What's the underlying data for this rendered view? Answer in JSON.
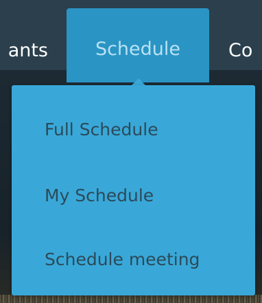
{
  "nav": {
    "items": [
      {
        "label": "ants"
      },
      {
        "label": "Schedule"
      },
      {
        "label": "Co"
      }
    ]
  },
  "dropdown": {
    "items": [
      {
        "label": "Full Schedule"
      },
      {
        "label": "My Schedule"
      },
      {
        "label": "Schedule meeting"
      }
    ]
  },
  "colors": {
    "navbar": "#2b3f4c",
    "active_tab": "#2a94c4",
    "dropdown": "#39a8d8",
    "menu_text": "#2c4a5a"
  }
}
